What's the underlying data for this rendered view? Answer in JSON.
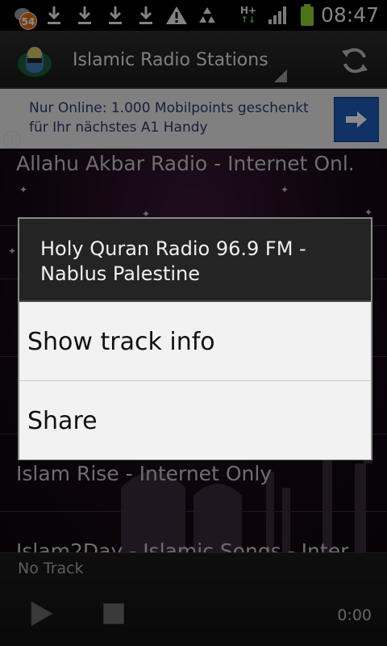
{
  "status_bar": {
    "notification_count": "54",
    "network_label": "H+",
    "time": "08:47"
  },
  "action_bar": {
    "title": "Islamic Radio Stations"
  },
  "ad": {
    "text": "Nur Online: 1.000 Mobilpoints geschenkt für Ihr nächstes A1 Handy",
    "info_glyph": "i"
  },
  "stations": [
    {
      "label": "Allahu Akbar Radio  -  Internet Onl."
    },
    {
      "label": "Islam Rise  -  Internet Only"
    },
    {
      "label": "Islam2Day - Islamic Songs - Inter..."
    }
  ],
  "dialog": {
    "title": "Holy Quran Radio 96.9 FM - Nablus Palestine",
    "items": [
      {
        "label": "Show track info"
      },
      {
        "label": "Share"
      }
    ]
  },
  "player": {
    "track": "No Track",
    "time": "0:00"
  },
  "colors": {
    "accent": "#1f5cb8",
    "badge": "#e0701a",
    "battery": "#8ccf2a"
  },
  "icons": [
    "download-icon",
    "warning-icon",
    "recycle-icon",
    "signal-icon",
    "battery-icon",
    "refresh-icon",
    "arrow-right-icon",
    "info-icon",
    "play-icon",
    "stop-icon"
  ]
}
